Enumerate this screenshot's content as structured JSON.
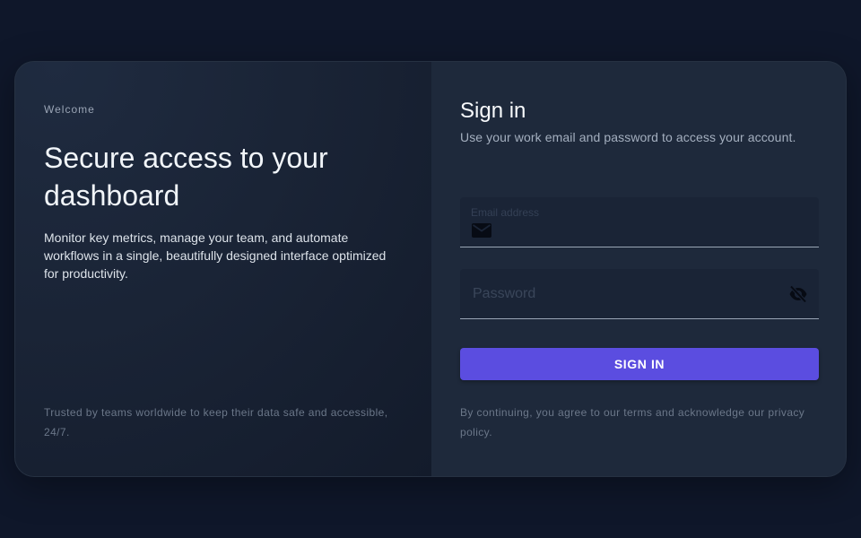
{
  "hero": {
    "eyebrow": "Welcome",
    "title": "Secure access to your dashboard",
    "description": "Monitor key metrics, manage your team, and automate workflows in a single, beautifully designed interface optimized for productivity.",
    "footnote": "Trusted by teams worldwide to keep their data safe and accessible, 24/7."
  },
  "form": {
    "title": "Sign in",
    "subtitle": "Use your work email and password to access your account.",
    "email": {
      "label": "Email address",
      "value": "",
      "icon": "mail-icon"
    },
    "password": {
      "placeholder": "Password",
      "value": "",
      "toggle_icon": "eye-off-icon"
    },
    "submit_label": "SIGN IN",
    "terms": "By continuing, you agree to our terms and acknowledge our privacy policy."
  },
  "colors": {
    "background": "#0f172a",
    "card": "#1e293b",
    "accent": "#5b4de0"
  }
}
